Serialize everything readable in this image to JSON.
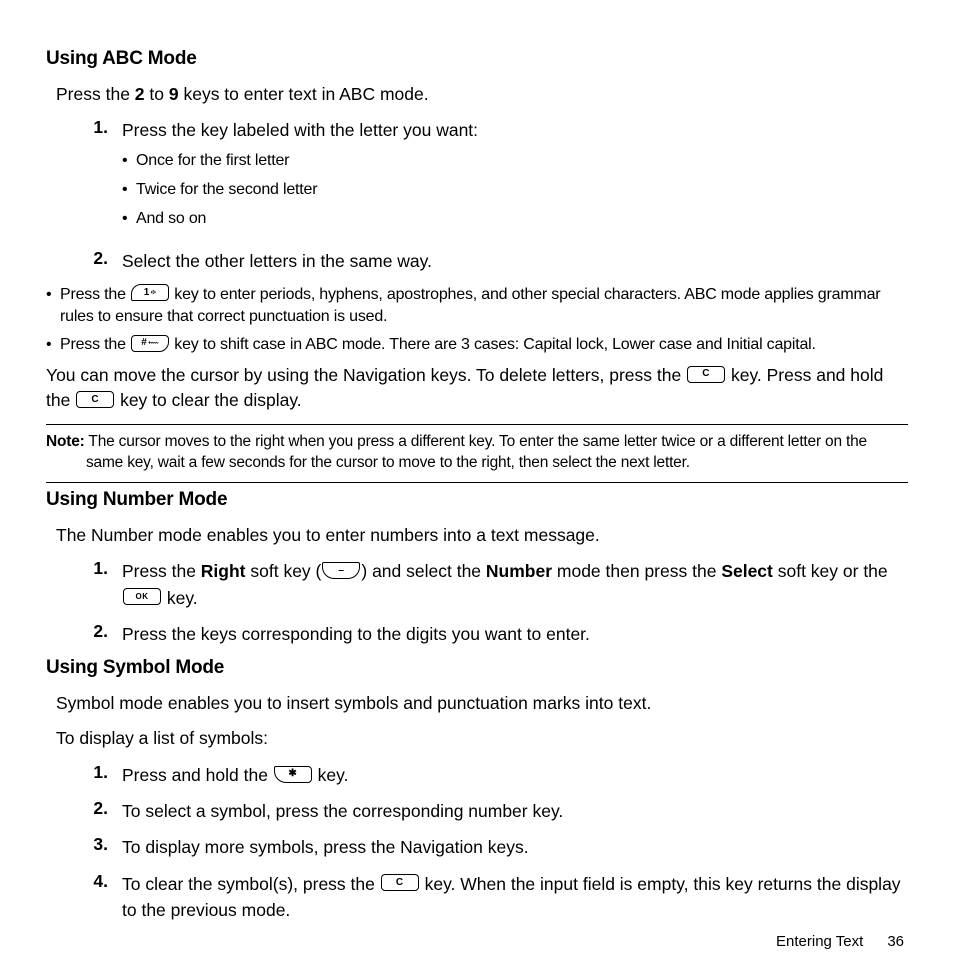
{
  "section_abc": {
    "heading": "Using ABC Mode",
    "intro_a": "Press the ",
    "intro_b": "2",
    "intro_c": " to ",
    "intro_d": "9",
    "intro_e": " keys to enter text in ABC mode.",
    "steps": [
      {
        "num": "1.",
        "text": "Press the key labeled with the letter you want:",
        "bullets": [
          "Once for the first letter",
          "Twice for the second letter",
          "And so on"
        ]
      },
      {
        "num": "2.",
        "text": "Select the other letters in the same way."
      }
    ],
    "sub_bullets": [
      {
        "pre": "Press the ",
        "icon": "key-1",
        "icon_label": "1",
        "post": " key to enter periods, hyphens, apostrophes, and other special characters. ABC mode applies grammar rules to ensure that correct punctuation is used."
      },
      {
        "pre": "Press the ",
        "icon": "key-hash",
        "icon_label": "#",
        "post": " key to shift case in ABC mode. There are 3 cases: Capital lock, Lower case and Initial capital."
      }
    ],
    "cursor_a": "You can move the cursor by using the Navigation keys. To delete letters, press the ",
    "cursor_icon": "key-c",
    "cursor_icon_label": "C",
    "cursor_b": " key. Press and hold the ",
    "cursor_icon2": "key-c",
    "cursor_icon2_label": "C",
    "cursor_c": " key to clear the display.",
    "note_label": "Note:",
    "note_text": " The cursor moves to the right when you press a different key. To enter the same letter twice or a different letter on the same key, wait a few seconds for the cursor to move to the right, then select the next letter."
  },
  "section_number": {
    "heading": "Using Number Mode",
    "intro": "The Number mode enables you to enter numbers into a text message.",
    "steps": [
      {
        "num": "1.",
        "pre": "Press the ",
        "b1": "Right",
        "mid1": " soft key (",
        "icon1": "soft-right",
        "icon1_label": "–",
        "mid2": ") and select the ",
        "b2": "Number",
        "mid3": " mode then press the ",
        "b3": "Select",
        "mid4": " soft key or the  ",
        "icon2": "key-ok",
        "icon2_label": "OK",
        "post": " key."
      },
      {
        "num": "2.",
        "text": "Press the keys corresponding to the digits you want to enter."
      }
    ]
  },
  "section_symbol": {
    "heading": "Using Symbol Mode",
    "intro": "Symbol mode enables you to insert symbols and punctuation marks into text.",
    "sub_intro": "To display a list of symbols:",
    "steps": [
      {
        "num": "1.",
        "pre": "Press and hold the ",
        "icon": "key-asterisk",
        "icon_label": "✱",
        "post": " key."
      },
      {
        "num": "2.",
        "text": "To select a symbol, press the corresponding number key."
      },
      {
        "num": "3.",
        "text": "To display more symbols, press the Navigation keys."
      },
      {
        "num": "4.",
        "pre": "To clear the symbol(s), press the ",
        "icon": "key-c",
        "icon_label": "C",
        "post": " key. When the input field is empty, this key returns the display to the previous mode."
      }
    ]
  },
  "footer": {
    "title": "Entering Text",
    "page": "36"
  }
}
